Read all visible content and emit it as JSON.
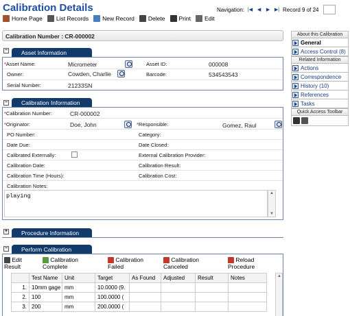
{
  "title": "Calibration Details",
  "navigation": {
    "label": "Navigation:",
    "record_text": "Record 9 of 24"
  },
  "toolbar": {
    "home": "Home Page",
    "list": "List Records",
    "new": "New Record",
    "delete": "Delete",
    "print": "Print",
    "edit": "Edit"
  },
  "header": {
    "calibration_number": "Calibration Number : CR-000002"
  },
  "asset": {
    "tab": "Asset Information",
    "asset_name_label": "Asset Name:",
    "asset_name": "Micrometer",
    "asset_id_label": "Asset ID:",
    "asset_id": "000008",
    "owner_label": "Owner:",
    "owner": "Cowden, Charlie",
    "barcode_label": "Barcode:",
    "barcode": "534543543",
    "serial_label": "Serial Number:",
    "serial": "21233SN"
  },
  "calibration": {
    "tab": "Calibration Information",
    "number_label": "Calibration Number:",
    "number": "CR-000002",
    "originator_label": "Originator:",
    "originator": "Doe, John",
    "responsible_label": "Responsible:",
    "responsible": "Gomez, Raul",
    "po_label": "PO Number:",
    "category_label": "Category:",
    "date_due_label": "Date Due:",
    "date_closed_label": "Date Closed:",
    "cal_ext_label": "Calibrated Externally:",
    "ext_provider_label": "External Calibration Provider:",
    "cal_date_label": "Calibration Date:",
    "cal_result_label": "Calibration Result:",
    "cal_time_label": "Calibration Time (Hours):",
    "cal_cost_label": "Calibration Cost:",
    "notes_label": "Calibration Notes:",
    "notes": "playing"
  },
  "procedure": {
    "tab": "Procedure Information"
  },
  "perform": {
    "tab": "Perform Calibration",
    "actions": {
      "edit": "Edit Result",
      "complete": "Calibration Complete",
      "failed": "Calibration Failed",
      "canceled": "Calibration Canceled",
      "reload": "Reload Procedure"
    },
    "columns": [
      "",
      "Test Name",
      "Unit",
      "Target",
      "As Found",
      "Adjusted",
      "Result",
      "Notes"
    ],
    "rows": [
      [
        "1.",
        "10mm gage",
        "mm",
        "10.0000 (9.",
        "",
        "",
        "",
        ""
      ],
      [
        "2.",
        "100",
        "mm",
        "100.0000 (",
        "",
        "",
        "",
        ""
      ],
      [
        "3.",
        "200",
        "mm",
        "200.0000 (",
        "",
        "",
        "",
        ""
      ]
    ]
  },
  "right_panel": {
    "about_header": "About this Calibration",
    "about_items": [
      "General",
      "Access Control (8)"
    ],
    "related_header": "Related Information",
    "related_items": [
      "Actions",
      "Correspondence",
      "History (10)",
      "References",
      "Tasks"
    ],
    "quick_header": "Quick Access Toolbar"
  }
}
